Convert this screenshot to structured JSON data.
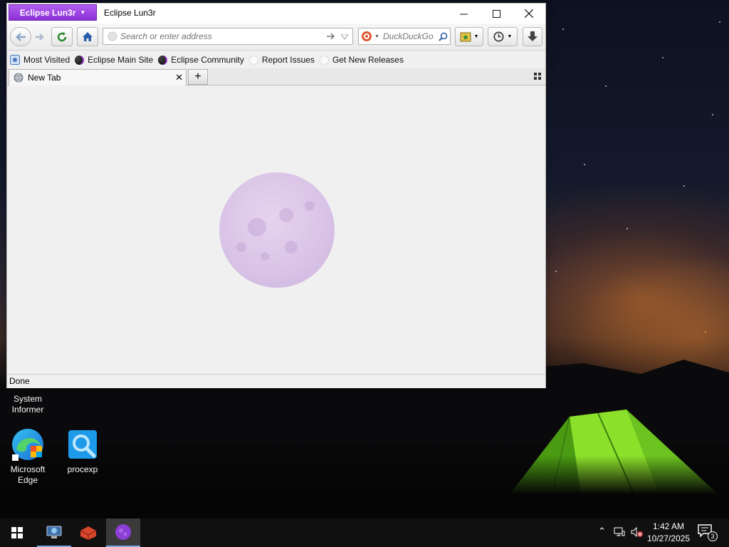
{
  "window": {
    "app_menu_label": "Eclipse Lun3r",
    "title": "Eclipse Lun3r"
  },
  "navbar": {
    "url_placeholder": "Search or enter address",
    "search_engine": "DuckDuckGo"
  },
  "bookmarks": [
    {
      "label": "Most Visited"
    },
    {
      "label": "Eclipse Main Site"
    },
    {
      "label": "Eclipse Community"
    },
    {
      "label": "Report Issues"
    },
    {
      "label": "Get New Releases"
    }
  ],
  "tabs": [
    {
      "label": "New Tab",
      "active": true
    }
  ],
  "status": {
    "text": "Done"
  },
  "desktop_icons": [
    {
      "label": "System Informer",
      "icon": "system-informer-icon"
    },
    {
      "label": "Microsoft Edge",
      "icon": "edge-icon"
    },
    {
      "label": "procexp",
      "icon": "procexp-icon"
    }
  ],
  "taskbar": {
    "time": "1:42 AM",
    "date": "10/27/2025",
    "notification_count": "3",
    "apps": [
      "network-app-icon",
      "firewall-app-icon",
      "eclipse-lun3r-icon"
    ]
  },
  "colors": {
    "accent_purple": "#8c2fd6",
    "taskbar": "#101010"
  }
}
